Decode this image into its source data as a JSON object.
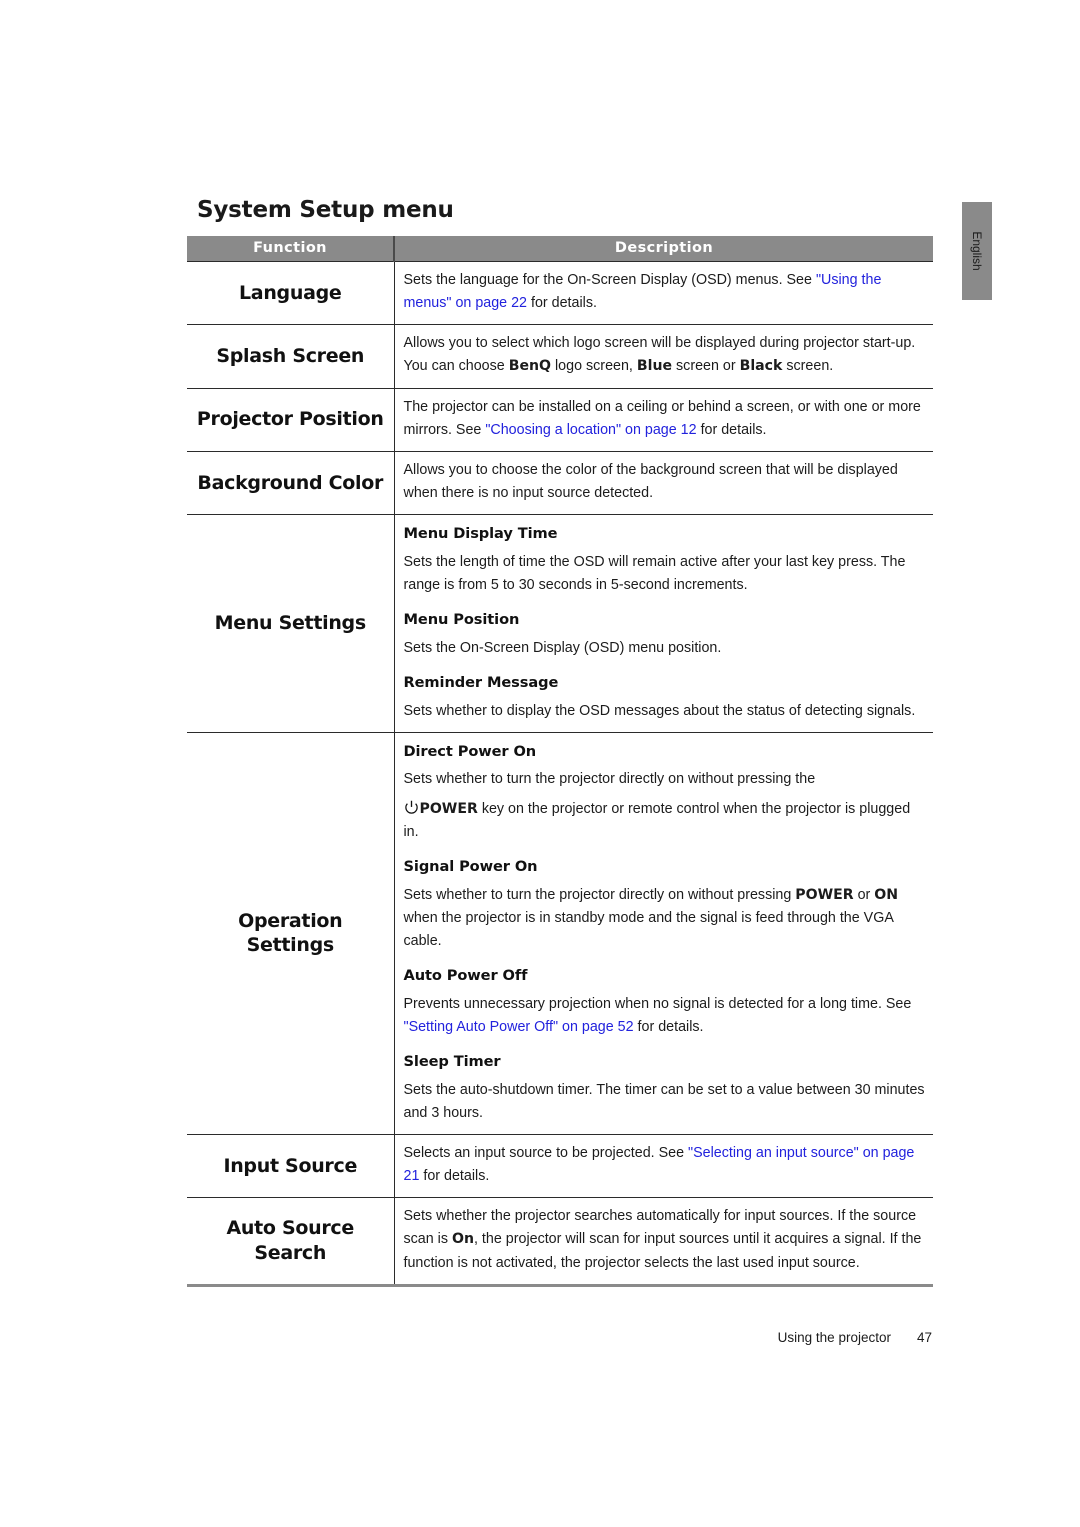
{
  "page": {
    "section_title": "System Setup menu",
    "language_tab": "English",
    "footer_label": "Using the projector",
    "footer_page_number": "47",
    "link_color": "#2222dd",
    "header_bg_color": "#8a8a8a",
    "header_text_color": "#ffffff"
  },
  "table": {
    "headers": {
      "function": "Function",
      "description": "Description"
    },
    "rows": [
      {
        "function": "Language",
        "blocks": [
          {
            "type": "paragraph",
            "runs": [
              {
                "text": "Sets the language for the On-Screen Display (OSD) menus. See ",
                "style": "normal"
              },
              {
                "text": "\"Using the menus\" on page 22",
                "style": "link"
              },
              {
                "text": " for details.",
                "style": "normal"
              }
            ]
          }
        ]
      },
      {
        "function": "Splash Screen",
        "blocks": [
          {
            "type": "paragraph",
            "runs": [
              {
                "text": "Allows you to select which logo screen will be displayed during projector start-up. You can choose ",
                "style": "normal"
              },
              {
                "text": "BenQ",
                "style": "bold"
              },
              {
                "text": " logo screen, ",
                "style": "normal"
              },
              {
                "text": "Blue",
                "style": "bold"
              },
              {
                "text": " screen or ",
                "style": "normal"
              },
              {
                "text": "Black",
                "style": "bold"
              },
              {
                "text": " screen.",
                "style": "normal"
              }
            ]
          }
        ]
      },
      {
        "function": "Projector Position",
        "blocks": [
          {
            "type": "paragraph",
            "runs": [
              {
                "text": "The projector can be installed on a ceiling or behind a screen, or with one or more mirrors. See ",
                "style": "normal"
              },
              {
                "text": "\"Choosing a location\" on page 12",
                "style": "link"
              },
              {
                "text": " for details.",
                "style": "normal"
              }
            ]
          }
        ]
      },
      {
        "function": "Background Color",
        "blocks": [
          {
            "type": "paragraph",
            "runs": [
              {
                "text": "Allows you to choose the color of the background screen that will be displayed when there is no input source detected.",
                "style": "normal"
              }
            ]
          }
        ]
      },
      {
        "function": "Menu Settings",
        "blocks": [
          {
            "type": "subhead",
            "text": "Menu Display Time"
          },
          {
            "type": "paragraph",
            "runs": [
              {
                "text": "Sets the length of time the OSD will remain active after your last key press. The range is from 5 to 30 seconds in 5-second increments.",
                "style": "normal"
              }
            ]
          },
          {
            "type": "subhead",
            "text": "Menu Position"
          },
          {
            "type": "paragraph",
            "runs": [
              {
                "text": "Sets the On-Screen Display (OSD) menu position.",
                "style": "normal"
              }
            ]
          },
          {
            "type": "subhead",
            "text": "Reminder Message"
          },
          {
            "type": "paragraph",
            "runs": [
              {
                "text": "Sets whether to display the OSD messages about the status of detecting signals.",
                "style": "normal"
              }
            ]
          }
        ]
      },
      {
        "function": "Operation Settings",
        "blocks": [
          {
            "type": "subhead",
            "text": "Direct Power On"
          },
          {
            "type": "paragraph",
            "runs": [
              {
                "text": "Sets whether to turn the projector directly on without pressing the",
                "style": "normal"
              }
            ]
          },
          {
            "type": "paragraph",
            "runs": [
              {
                "text": "",
                "style": "power-icon"
              },
              {
                "text": "POWER",
                "style": "bold"
              },
              {
                "text": " key on the projector or remote control when the projector is plugged in.",
                "style": "normal"
              }
            ]
          },
          {
            "type": "subhead",
            "text": "Signal Power On"
          },
          {
            "type": "paragraph",
            "runs": [
              {
                "text": "Sets whether to turn the projector directly on without pressing ",
                "style": "normal"
              },
              {
                "text": "POWER",
                "style": "bold"
              },
              {
                "text": " or ",
                "style": "normal"
              },
              {
                "text": "ON",
                "style": "bold"
              },
              {
                "text": " when the projector is in standby mode and the signal is feed through the VGA cable.",
                "style": "normal"
              }
            ]
          },
          {
            "type": "subhead",
            "text": "Auto Power Off"
          },
          {
            "type": "paragraph",
            "runs": [
              {
                "text": "Prevents unnecessary projection when no signal is detected for a long time. See ",
                "style": "normal"
              },
              {
                "text": "\"Setting Auto Power Off\" on page 52",
                "style": "link"
              },
              {
                "text": " for details.",
                "style": "normal"
              }
            ]
          },
          {
            "type": "subhead",
            "text": "Sleep Timer"
          },
          {
            "type": "paragraph",
            "runs": [
              {
                "text": "Sets the auto-shutdown timer. The timer can be set to a value between 30 minutes and 3 hours.",
                "style": "normal"
              }
            ]
          }
        ]
      },
      {
        "function": "Input Source",
        "blocks": [
          {
            "type": "paragraph",
            "runs": [
              {
                "text": "Selects an input source to be projected. See ",
                "style": "normal"
              },
              {
                "text": "\"Selecting an input source\" on page 21",
                "style": "link"
              },
              {
                "text": " for details.",
                "style": "normal"
              }
            ]
          }
        ]
      },
      {
        "function": "Auto Source Search",
        "blocks": [
          {
            "type": "paragraph",
            "runs": [
              {
                "text": "Sets whether the projector searches automatically for input sources. If the source scan is ",
                "style": "normal"
              },
              {
                "text": "On",
                "style": "bold"
              },
              {
                "text": ", the projector will scan for input sources until it acquires a signal. If the function is not activated, the projector selects the last used input source.",
                "style": "normal"
              }
            ]
          }
        ]
      }
    ]
  }
}
